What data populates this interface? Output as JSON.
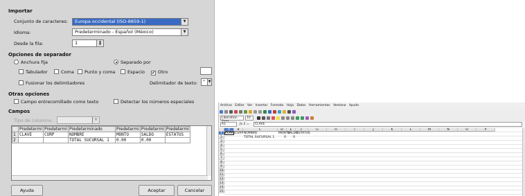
{
  "dialog": {
    "import_heading": "Importar",
    "charset_label": "Conjunto de caracteres:",
    "charset_value": "Europa occidental (ISO-8859-1)",
    "language_label": "Idioma:",
    "language_value": "Predeterminado - Español (México)",
    "from_row_label": "Desde la fila:",
    "from_row_value": "1",
    "separator_heading": "Opciones de separador",
    "fixed_width": "Anchura fija",
    "separated_by": "Separado por",
    "tab": "Tabulador",
    "comma": "Coma",
    "semicolon": "Punto y coma",
    "space": "Espacio",
    "other": "Otro",
    "merge_delimiters": "Fusionar los delimitadores",
    "text_delimiter_label": "Delimitador de texto:",
    "text_delimiter_value": "\"",
    "other_heading": "Otras opciones",
    "quoted_as_text": "Campo entrecomillado como texto",
    "detect_numbers": "Detectar los números especiales",
    "fields_heading": "Campos",
    "column_type_label": "Tipo de columna:",
    "preview": {
      "headers": [
        "Predetermi",
        "Predetermi",
        "Predeterminado",
        "Predetermi",
        "Predetermi",
        "Predetermi"
      ],
      "rows": [
        [
          "1",
          "CLAVE",
          "CURP",
          "NOMBRE",
          "MONTO",
          "SALDO",
          "ESTATUS"
        ],
        [
          "2",
          "",
          "",
          "TOTAL SUCURSAL 1",
          "0.00",
          "0.00",
          ""
        ]
      ]
    },
    "help_button": "Ayuda",
    "ok_button": "Aceptar",
    "cancel_button": "Cancelar"
  },
  "calc": {
    "menu": [
      "Archivo",
      "Editar",
      "Ver",
      "Insertar",
      "Formato",
      "Hoja",
      "Datos",
      "Herramientas",
      "Ventana",
      "Ayuda"
    ],
    "font_name": "Liberation Sans",
    "font_size": "10",
    "name_box": "A1",
    "formula": "CLAVE",
    "columns": [
      "A",
      "B",
      "C",
      "D",
      "E",
      "F",
      "G",
      "H",
      "I",
      "J",
      "K",
      "L",
      "M",
      "N",
      "O",
      "P"
    ],
    "row_numbers": [
      "1",
      "2",
      "3",
      "4",
      "5",
      "6",
      "7",
      "8",
      "9",
      "10",
      "11",
      "12",
      "13",
      "14",
      "15"
    ],
    "cells": {
      "a1": "CLAVE",
      "b1": "CURP",
      "c1": "NOMBRE",
      "d1": "MONTO",
      "e1": "SALDO",
      "f1": "ESTATUS",
      "c2": "TOTAL SUCURSAL 1",
      "d2": "0",
      "e2": "0"
    }
  }
}
